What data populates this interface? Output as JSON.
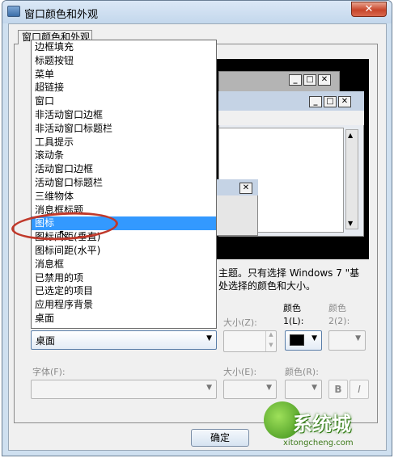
{
  "window": {
    "title": "窗口颜色和外观",
    "close_glyph": "✕"
  },
  "tab": {
    "label": "窗口颜色和外观"
  },
  "preview": {
    "caption_glyphs": [
      "_",
      "□",
      "✕"
    ],
    "scroll_up": "▲",
    "scroll_down": "▼"
  },
  "description": {
    "line1": "主题。只有选择 Windows 7 \"基",
    "line2": "处选择的颜色和大小。"
  },
  "dropdown_list": {
    "items": [
      "边框填充",
      "标题按钮",
      "菜单",
      "超链接",
      "窗口",
      "非活动窗口边框",
      "非活动窗口标题栏",
      "工具提示",
      "滚动条",
      "活动窗口边框",
      "活动窗口标题栏",
      "三维物体",
      "消息框标题",
      "图标",
      "图标间距(垂直)",
      "图标间距(水平)",
      "消息框",
      "已禁用的项",
      "已选定的项目",
      "应用程序背景",
      "桌面"
    ],
    "selected_index": 13
  },
  "controls": {
    "item_select_value": "桌面",
    "size_label": "大小(Z):",
    "color1_label_a": "颜色",
    "color1_label_b": "1(L):",
    "color2_label_a": "颜色",
    "color2_label_b": "2(2):",
    "font_label": "字体(F):",
    "font_size_label": "大小(E):",
    "font_color_label": "颜色(R):",
    "bold_label": "B",
    "italic_label": "I",
    "color1_value": "#000000"
  },
  "buttons": {
    "ok_label": "确定"
  },
  "watermark": {
    "text": "系统城",
    "url": "xitongcheng.com"
  },
  "colors": {
    "selection": "#3399ff",
    "highlight_oval": "#c0392b",
    "titlebar": "#c3d7ec"
  }
}
